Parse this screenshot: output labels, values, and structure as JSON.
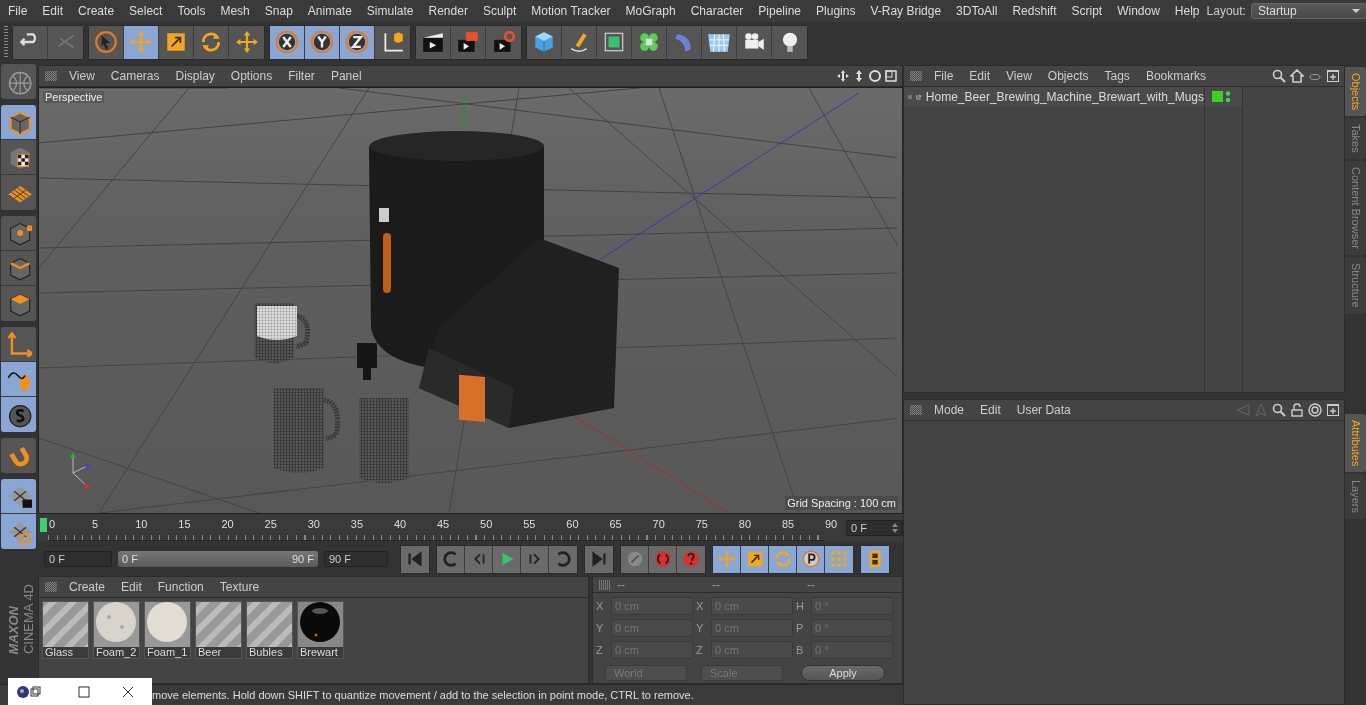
{
  "menu_bar": {
    "items": [
      "File",
      "Edit",
      "Create",
      "Select",
      "Tools",
      "Mesh",
      "Snap",
      "Animate",
      "Simulate",
      "Render",
      "Sculpt",
      "Motion Tracker",
      "MoGraph",
      "Character",
      "Pipeline",
      "Plugins",
      "V-Ray Bridge",
      "3DToAll",
      "Redshift",
      "Script",
      "Window",
      "Help"
    ],
    "layout_label": "Layout:",
    "layout_value": "Startup"
  },
  "toolbar": {
    "groups": [
      [
        {
          "kind": "undo",
          "selected": false
        },
        {
          "kind": "redo",
          "selected": false
        }
      ],
      [
        {
          "kind": "select",
          "selected": false
        },
        {
          "kind": "move",
          "selected": true
        },
        {
          "kind": "scale",
          "selected": false
        },
        {
          "kind": "rotate",
          "selected": false
        },
        {
          "kind": "place",
          "selected": false
        }
      ],
      [
        {
          "kind": "x",
          "selected": true
        },
        {
          "kind": "y",
          "selected": true
        },
        {
          "kind": "z",
          "selected": true
        },
        {
          "kind": "coords",
          "selected": false
        }
      ],
      [
        {
          "kind": "render-view",
          "selected": false
        },
        {
          "kind": "render-picture",
          "selected": false
        },
        {
          "kind": "render-settings",
          "selected": false
        }
      ],
      [
        {
          "kind": "cube",
          "selected": false
        },
        {
          "kind": "pen",
          "selected": false
        },
        {
          "kind": "subdivision",
          "selected": false
        },
        {
          "kind": "cloner",
          "selected": false
        },
        {
          "kind": "deformer",
          "selected": false
        },
        {
          "kind": "floor",
          "selected": false
        },
        {
          "kind": "camera",
          "selected": false
        },
        {
          "kind": "light",
          "selected": false
        }
      ]
    ]
  },
  "left_tools": {
    "groups": [
      [
        {
          "kind": "view-switch",
          "selected": false
        }
      ],
      [
        {
          "kind": "model",
          "selected": true
        },
        {
          "kind": "texture",
          "selected": false
        },
        {
          "kind": "workplane",
          "selected": false
        }
      ],
      [
        {
          "kind": "points",
          "selected": false
        },
        {
          "kind": "edges",
          "selected": false
        },
        {
          "kind": "polygons",
          "selected": false
        }
      ],
      [
        {
          "kind": "axis",
          "selected": false
        },
        {
          "kind": "tweak",
          "selected": true
        },
        {
          "kind": "solo",
          "selected": true
        }
      ],
      [
        {
          "kind": "magnet",
          "selected": false
        }
      ],
      [
        {
          "kind": "lock-grid",
          "selected": true
        },
        {
          "kind": "grid-rotate",
          "selected": true
        }
      ]
    ],
    "logo": [
      "MAXON",
      "CINEMA 4D"
    ]
  },
  "viewport": {
    "menu": [
      "View",
      "Cameras",
      "Display",
      "Options",
      "Filter",
      "Panel"
    ],
    "camera_label": "Perspective",
    "grid_spacing": "Grid Spacing : 100 cm"
  },
  "timeline": {
    "ticks": [
      "0",
      "5",
      "10",
      "15",
      "20",
      "25",
      "30",
      "35",
      "40",
      "45",
      "50",
      "55",
      "60",
      "65",
      "70",
      "75",
      "80",
      "85",
      "90"
    ],
    "current_frame": "0 F"
  },
  "playback": {
    "start": "0 F",
    "range": {
      "start": "0 F",
      "end": "90 F",
      "level": 1
    },
    "end": "90 F",
    "buttons": [
      {
        "kind": "first",
        "selected": false
      },
      {
        "kind": "prev-key",
        "selected": false
      },
      {
        "kind": "prev-frame",
        "selected": false
      },
      {
        "kind": "play",
        "selected": false
      },
      {
        "kind": "next-frame",
        "selected": false
      },
      {
        "kind": "next-key",
        "selected": false
      },
      {
        "kind": "last",
        "selected": false
      },
      {
        "kind": "record",
        "selected": false
      },
      {
        "kind": "autokey",
        "selected": false
      },
      {
        "kind": "help",
        "selected": false
      },
      {
        "kind": "move",
        "selected": true
      },
      {
        "kind": "scale",
        "selected": true
      },
      {
        "kind": "rotate",
        "selected": true
      },
      {
        "kind": "param",
        "selected": true
      },
      {
        "kind": "points",
        "selected": true
      },
      {
        "kind": "film",
        "selected": true
      }
    ]
  },
  "materials": {
    "menu": [
      "Create",
      "Edit",
      "Function",
      "Texture"
    ],
    "items": [
      {
        "name": "Glass",
        "kind": "striped"
      },
      {
        "name": "Foam_2",
        "kind": "speckled"
      },
      {
        "name": "Foam_1",
        "kind": "light"
      },
      {
        "name": "Beer",
        "kind": "striped"
      },
      {
        "name": "Bubles",
        "kind": "striped"
      },
      {
        "name": "Brewart",
        "kind": "dark"
      }
    ]
  },
  "coordinates": {
    "headers": [
      "--",
      "--",
      "--"
    ],
    "disabled": true,
    "rows": [
      [
        {
          "axis": "X",
          "value": "0 cm"
        },
        {
          "axis": "X",
          "value": "0 cm"
        },
        {
          "axis": "H",
          "value": "0 °"
        }
      ],
      [
        {
          "axis": "Y",
          "value": "0 cm"
        },
        {
          "axis": "Y",
          "value": "0 cm"
        },
        {
          "axis": "P",
          "value": "0 °"
        }
      ],
      [
        {
          "axis": "Z",
          "value": "0 cm"
        },
        {
          "axis": "Z",
          "value": "0 cm"
        },
        {
          "axis": "B",
          "value": "0 °"
        }
      ]
    ],
    "dropdowns": [
      "World",
      "Scale"
    ],
    "apply": "Apply"
  },
  "status_text": "move elements. Hold down SHIFT to quantize movement / add to the selection in point mode, CTRL to remove.",
  "objects": {
    "menu": [
      "File",
      "Edit",
      "View",
      "Objects",
      "Tags",
      "Bookmarks"
    ],
    "items": [
      {
        "name": "Home_Beer_Brewing_Machine_Brewart_with_Mugs",
        "expanded": false
      }
    ]
  },
  "attributes": {
    "menu": [
      "Mode",
      "Edit",
      "User Data"
    ]
  },
  "side_tabs_top": [
    {
      "label": "Objects",
      "selected": true
    },
    {
      "label": "Takes",
      "selected": false
    },
    {
      "label": "Content Browser",
      "selected": false
    },
    {
      "label": "Structure",
      "selected": false
    }
  ],
  "side_tabs_bottom": [
    {
      "label": "Attributes",
      "selected": true
    },
    {
      "label": "Layers",
      "selected": false
    }
  ]
}
